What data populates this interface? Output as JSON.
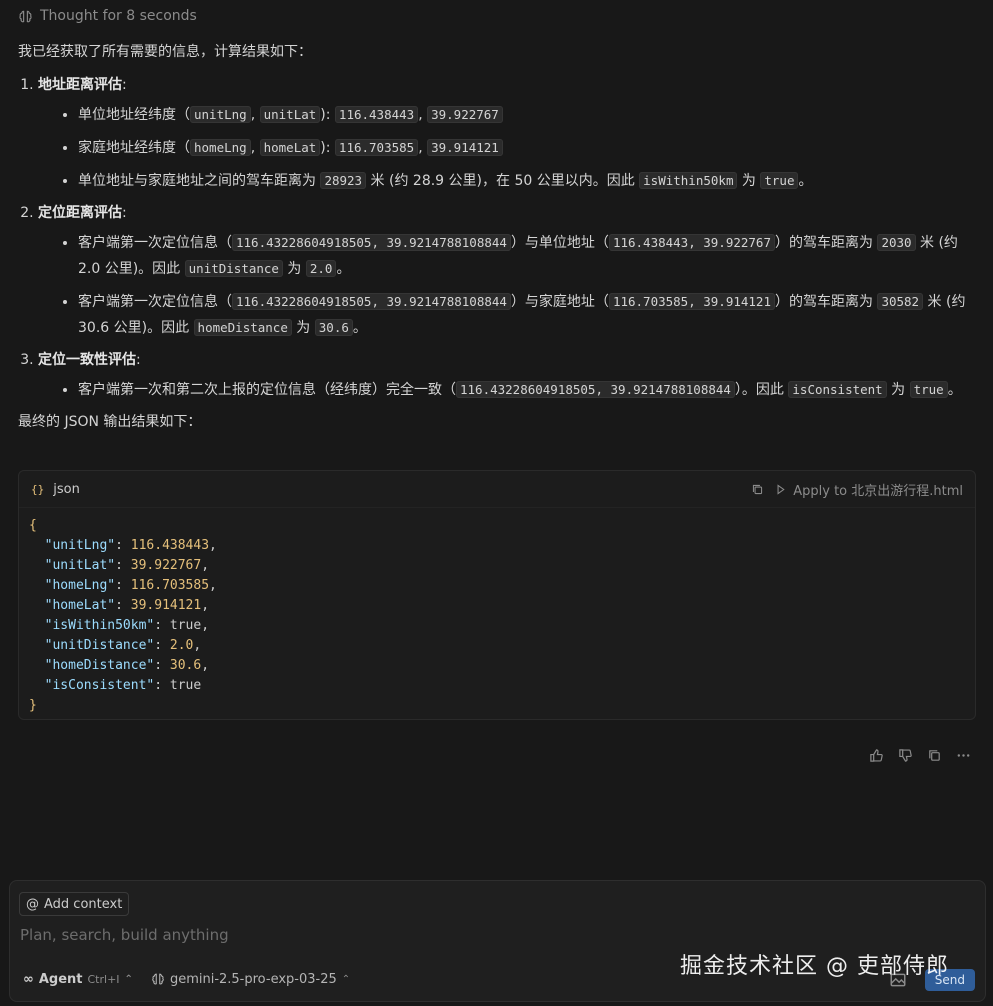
{
  "thought": {
    "label": "Thought for 8 seconds"
  },
  "message": {
    "intro": "我已经获取了所有需要的信息，计算结果如下：",
    "section1": {
      "title": "地址距离评估",
      "b1_text": "单位地址经纬度（",
      "b1_lng_key": "unitLng",
      "b1_lat_key": "unitLat",
      "b1_mid": "): ",
      "b1_lng_val": "116.438443",
      "b1_lat_val": "39.922767",
      "b2_text": "家庭地址经纬度（",
      "b2_lng_key": "homeLng",
      "b2_lat_key": "homeLat",
      "b2_mid": "): ",
      "b2_lng_val": "116.703585",
      "b2_lat_val": "39.914121",
      "b3_pre": "单位地址与家庭地址之间的驾车距离为 ",
      "b3_meters": "28923",
      "b3_mid": " 米 (约 28.9 公里)，在 50 公里以内。因此 ",
      "b3_key": "isWithin50km",
      "b3_for": " 为 ",
      "b3_val": "true",
      "b3_end": "。"
    },
    "section2": {
      "title": "定位距离评估",
      "b1_pre": "客户端第一次定位信息（",
      "b1_coord": "116.43228604918505, 39.9214788108844",
      "b1_mid": "）与单位地址（",
      "b1_addr": "116.438443, 39.922767",
      "b1_mid2": "）的驾车距离为 ",
      "b1_meters": "2030",
      "b1_tail": " 米 (约 2.0 公里)。因此 ",
      "b1_key": "unitDistance",
      "b1_for": " 为 ",
      "b1_val": "2.0",
      "b1_end": "。",
      "b2_pre": "客户端第一次定位信息（",
      "b2_coord": "116.43228604918505, 39.9214788108844",
      "b2_mid": "）与家庭地址（",
      "b2_addr": "116.703585, 39.914121",
      "b2_mid2": "）的驾车距离为 ",
      "b2_meters": "30582",
      "b2_tail": " 米 (约 30.6 公里)。因此 ",
      "b2_key": "homeDistance",
      "b2_for": " 为 ",
      "b2_val": "30.6",
      "b2_end": "。"
    },
    "section3": {
      "title": "定位一致性评估",
      "b1_pre": "客户端第一次和第二次上报的定位信息（经纬度）完全一致（",
      "b1_coord": "116.43228604918505, 39.9214788108844",
      "b1_mid": "）。因此 ",
      "b1_key": "isConsistent",
      "b1_for": " 为 ",
      "b1_val": "true",
      "b1_end": "。"
    },
    "outro": "最终的 JSON 输出结果如下："
  },
  "codeblock": {
    "language": "json",
    "apply_label": "Apply to 北京出游行程.html",
    "lines": [
      {
        "key": "\"unitLng\"",
        "value": "116.438443",
        "numeric": true
      },
      {
        "key": "\"unitLat\"",
        "value": "39.922767",
        "numeric": true
      },
      {
        "key": "\"homeLng\"",
        "value": "116.703585",
        "numeric": true
      },
      {
        "key": "\"homeLat\"",
        "value": "39.914121",
        "numeric": true
      },
      {
        "key": "\"isWithin50km\"",
        "value": "true",
        "numeric": false
      },
      {
        "key": "\"unitDistance\"",
        "value": "2.0",
        "numeric": true
      },
      {
        "key": "\"homeDistance\"",
        "value": "30.6",
        "numeric": true
      },
      {
        "key": "\"isConsistent\"",
        "value": "true",
        "numeric": false
      }
    ]
  },
  "composer": {
    "add_context": "Add context",
    "placeholder": "Plan, search, build anything",
    "mode": "Agent",
    "mode_shortcut": "Ctrl+I",
    "model": "gemini-2.5-pro-exp-03-25",
    "send": "Send"
  },
  "watermark": "掘金技术社区 @ 吏部侍郎",
  "colors": {
    "background": "#181818",
    "accent": "#2f5d99",
    "json_key": "#9cdcfe",
    "json_number": "#e5c07b"
  }
}
